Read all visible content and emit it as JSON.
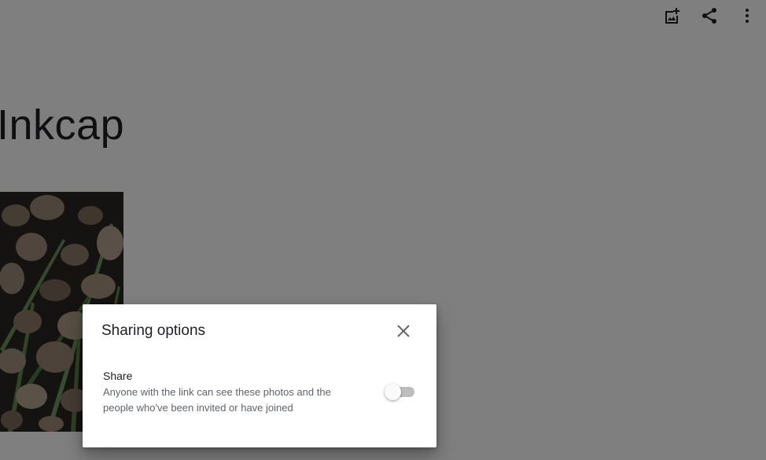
{
  "toolbar": {
    "icons": [
      "add-photo-icon",
      "share-icon",
      "more-vert-icon"
    ]
  },
  "album": {
    "title": "Inkcap"
  },
  "photo": {
    "subject": "inkcap-mushrooms"
  },
  "dialog": {
    "title": "Sharing options",
    "close_icon": "close-icon",
    "option": {
      "label": "Share",
      "description": "Anyone with the link can see these photos and the people who've been invited or have joined",
      "enabled": false
    }
  },
  "colors": {
    "scrim": "#000000",
    "toggle_track": "#bdbdbd",
    "toggle_thumb": "#fafafa",
    "dialog_bg": "#ffffff"
  }
}
